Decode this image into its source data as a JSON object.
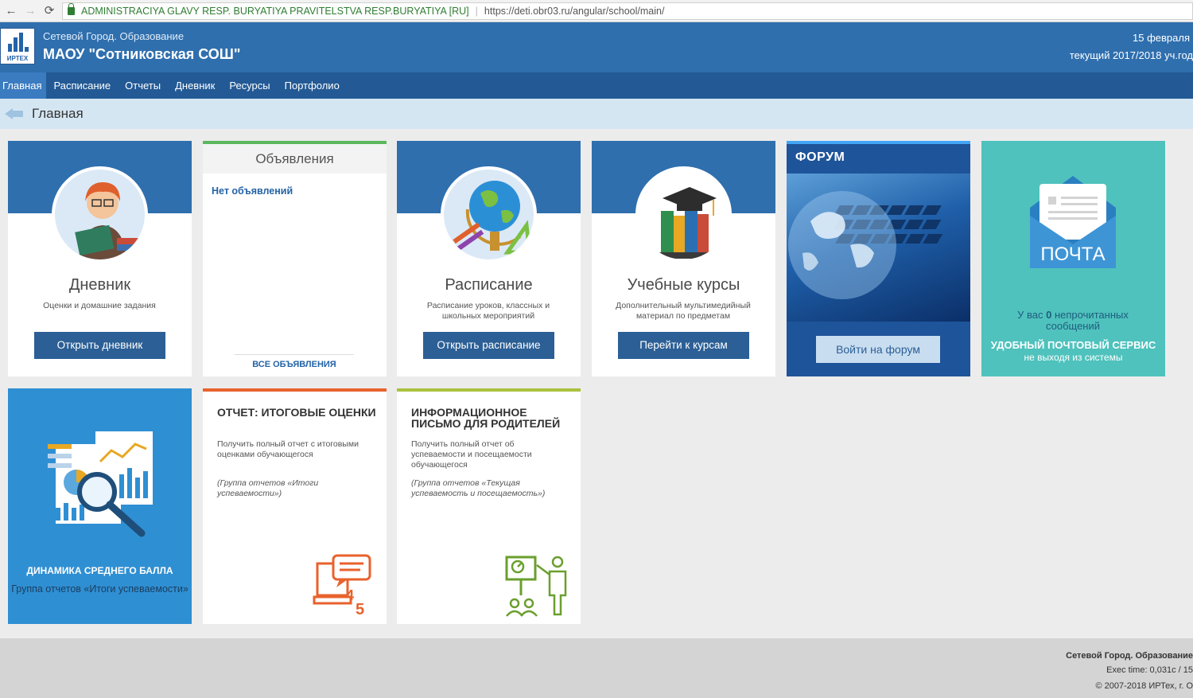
{
  "browser": {
    "cert": "ADMINISTRACIYA GLAVY RESP. BURYATIYA PRAVITELSTVA RESP.BURYATIYA [RU]",
    "url": "https://deti.obr03.ru/angular/school/main/"
  },
  "header": {
    "logo_text": "ИРТЕХ",
    "subtitle": "Сетевой Город. Образование",
    "school": "МАОУ \"Сотниковская СОШ\"",
    "date": "15 февраля",
    "year": "текущий 2017/2018 уч.год"
  },
  "menu": [
    {
      "label": "Главная"
    },
    {
      "label": "Расписание"
    },
    {
      "label": "Отчеты"
    },
    {
      "label": "Дневник"
    },
    {
      "label": "Ресурсы"
    },
    {
      "label": "Портфолио"
    }
  ],
  "breadcrumb": "Главная",
  "cards": {
    "diary": {
      "title": "Дневник",
      "desc": "Оценки и домашние задания",
      "button": "Открыть дневник"
    },
    "announcements": {
      "title": "Объявления",
      "empty": "Нет объявлений",
      "all": "ВСЕ ОБЪЯВЛЕНИЯ"
    },
    "schedule": {
      "title": "Расписание",
      "desc": "Расписание уроков, классных и школьных мероприятий",
      "button": "Открыть расписание"
    },
    "courses": {
      "title": "Учебные курсы",
      "desc": "Дополнительный мультимедийный материал по предметам",
      "button": "Перейти к курсам"
    },
    "forum": {
      "title": "ФОРУМ",
      "button": "Войти на форум"
    },
    "mail": {
      "title": "ПОЧТА",
      "unread_prefix": "У вас ",
      "unread_count": "0",
      "unread_suffix": " непрочитанных сообщений",
      "sub1": "УДОБНЫЙ ПОЧТОВЫЙ СЕРВИС",
      "sub2": "не выходя из системы"
    },
    "dynamics": {
      "title": "ДИНАМИКА СРЕДНЕГО БАЛЛА",
      "sub": "Группа отчетов «Итоги успеваемости»"
    },
    "final_report": {
      "title": "ОТЧЕТ: ИТОГОВЫЕ ОЦЕНКИ",
      "desc": "Получить полный отчет с итоговыми оценками обучающегося",
      "group": "(Группа отчетов «Итоги успеваемости»)"
    },
    "info_letter": {
      "title": "ИНФОРМАЦИОННОЕ ПИСЬМО ДЛЯ РОДИТЕЛЕЙ",
      "desc": "Получить полный отчет об успеваемости и посещаемости обучающегося",
      "group": "(Группа отчетов «Текущая успеваемость и посещаемость»)"
    }
  },
  "footer": {
    "line1": "Сетевой Город. Образование",
    "line2": "Exec time: 0,031c / 15",
    "line3": "© 2007-2018 ИРТех, г. О"
  },
  "colors": {
    "header": "#2f6fae",
    "menu": "#235a95",
    "button": "#2b5f95",
    "mail": "#4fc2bd",
    "dynamics": "#2f8fd3",
    "report_orange": "#e8622c",
    "report_olive": "#a9c23f"
  }
}
